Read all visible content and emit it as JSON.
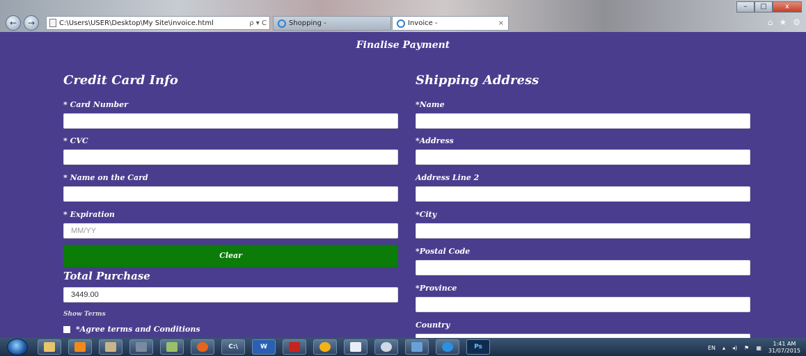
{
  "browser": {
    "address_url": "C:\\Users\\USER\\Desktop\\My Site\\invoice.html",
    "address_controls": "ρ ▾ C",
    "tabs": [
      {
        "label": "Shopping -",
        "active": false
      },
      {
        "label": "Invoice -",
        "active": true
      }
    ],
    "tab_close": "×",
    "window_buttons": [
      "–",
      "□",
      "x"
    ],
    "nav": {
      "back": "←",
      "forward": "→"
    },
    "right_icons": [
      "⌂",
      "★",
      "⚙"
    ]
  },
  "page": {
    "title": "Finalise Payment",
    "credit_card": {
      "heading": "Credit Card Info",
      "fields": [
        {
          "label": "* Card Number",
          "value": "",
          "placeholder": ""
        },
        {
          "label": "* CVC",
          "value": "",
          "placeholder": ""
        },
        {
          "label": "* Name on the Card",
          "value": "",
          "placeholder": ""
        },
        {
          "label": "* Expiration",
          "value": "",
          "placeholder": "MM/YY"
        }
      ],
      "clear_button": "Clear",
      "total_heading": "Total Purchase",
      "total_value": "3449.00",
      "show_terms": "Show Terms",
      "agree_label": "*Agree terms and Conditions"
    },
    "shipping": {
      "heading": "Shipping Address",
      "fields": [
        {
          "label": "*Name",
          "value": ""
        },
        {
          "label": "*Address",
          "value": ""
        },
        {
          "label": "Address Line 2",
          "value": ""
        },
        {
          "label": "*City",
          "value": ""
        },
        {
          "label": "*Postal Code",
          "value": ""
        },
        {
          "label": "*Province",
          "value": ""
        },
        {
          "label": "Country",
          "value": ""
        }
      ]
    }
  },
  "taskbar": {
    "icons": [
      "explorer",
      "media-player",
      "scanner",
      "app",
      "notepad",
      "firefox",
      "cmd",
      "word",
      "acrobat",
      "chrome",
      "app2",
      "paint",
      "files",
      "internet-explorer",
      "photoshop"
    ],
    "labels": {
      "cmd": "C:\\",
      "word": "W",
      "photoshop": "Ps"
    },
    "tray": {
      "lang": "EN",
      "time": "1:41 AM",
      "date": "31/07/2015"
    }
  },
  "colors": {
    "page_bg": "#4a3d8e",
    "clear_button_bg": "#0a7c07",
    "input_bg": "#ffffff"
  }
}
